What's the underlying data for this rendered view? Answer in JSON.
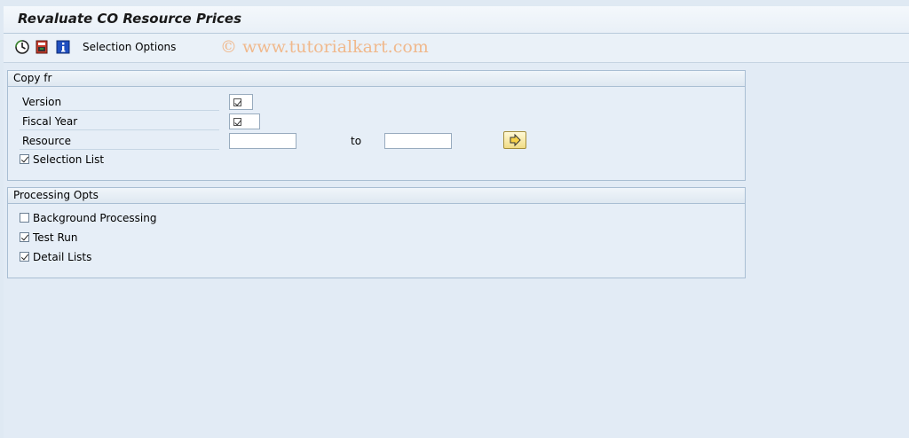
{
  "title": "Revaluate CO Resource Prices",
  "toolbar": {
    "selection_options_label": "Selection Options",
    "watermark": "© www.tutorialkart.com"
  },
  "copy_group": {
    "header": "Copy fr",
    "version_label": "Version",
    "fiscal_year_label": "Fiscal Year",
    "resource_label": "Resource",
    "resource_from_value": "",
    "to_label": "to",
    "resource_to_value": "",
    "selection_list_label": "Selection List",
    "selection_list_checked": true
  },
  "processing_group": {
    "header": "Processing Opts",
    "background_processing_label": "Background Processing",
    "background_processing_checked": false,
    "test_run_label": "Test Run",
    "test_run_checked": true,
    "detail_lists_label": "Detail Lists",
    "detail_lists_checked": true
  },
  "icons": [
    "execute-icon",
    "save-variant-icon",
    "info-icon",
    "multiple-selection-icon"
  ],
  "colors": {
    "background": "#e2ebf5",
    "group_border": "#a9bed3",
    "watermark": "#f0b98d",
    "button_yellow": "#f1dc86"
  }
}
